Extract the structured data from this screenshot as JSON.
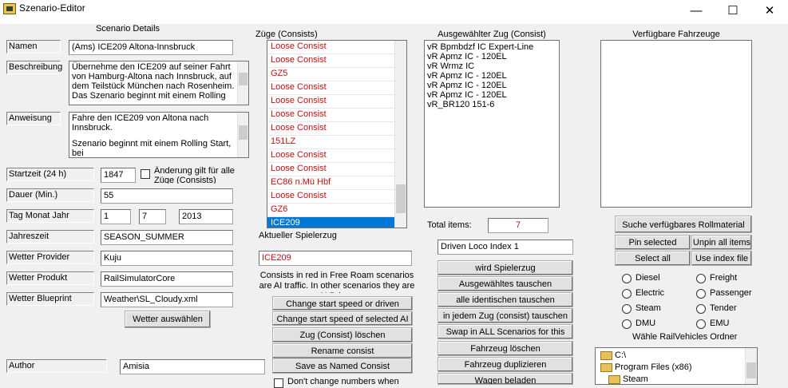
{
  "window": {
    "title": "Szenario-Editor",
    "minimize": "—",
    "maximize": "☐",
    "close": "✕"
  },
  "details": {
    "heading": "Scenario Details",
    "name_label": "Namen",
    "name_value": "(Ams) ICE209 Altona-Innsbruck",
    "desc_label": "Beschreibung",
    "desc_value": "Übernehme den ICE209 auf seiner Fahrt von Hamburg-Altona nach Innsbruck, auf dem Teilstück München nach Rosenheim. Das Szenario beginnt mit einem Rolling",
    "instr_label": "Anweisung",
    "instr_line1": "Fahre den ICE209 von Altona nach Innsbruck.",
    "instr_line2": "Szenario beginnt mit einem Rolling Start, bei",
    "start_label": "Startzeit (24 h)",
    "start_value": "1847",
    "change_all_label": "Änderung gilt für alle Züge (Consists)",
    "duration_label": "Dauer (Min.)",
    "duration_value": "55",
    "date_label": "Tag Monat Jahr",
    "day": "1",
    "month": "7",
    "year": "2013",
    "season_label": "Jahreszeit",
    "season_value": "SEASON_SUMMER",
    "weather_provider_label": "Wetter Provider",
    "weather_provider_value": "Kuju",
    "weather_product_label": "Wetter Produkt",
    "weather_product_value": "RailSimulatorCore",
    "weather_blueprint_label": "Wetter Blueprint",
    "weather_blueprint_value": "Weather\\SL_Cloudy.xml",
    "weather_button": "Wetter auswählen",
    "author_label": "Author",
    "author_value": "Amisia"
  },
  "consists": {
    "heading": "Züge (Consists)",
    "items": [
      "Loose Consist",
      "Loose Consist",
      "GZ5",
      "Loose Consist",
      "Loose Consist",
      "Loose Consist",
      "Loose Consist",
      "151LZ",
      "Loose Consist",
      "Loose Consist",
      "EC86 n.Mü Hbf",
      "Loose Consist",
      "GZ6",
      "ICE209"
    ],
    "player_label": "Aktueller Spielerzug",
    "player_value": "ICE209",
    "info": "Consists in red in Free Roam scenarios are AI traffic. In other scenarios they are AI Driven",
    "btn_change_start": "Change start speed or driven consist",
    "btn_change_start_ai": "Change start speed of selected AI consist",
    "btn_delete": "Zug (Consist) löschen",
    "btn_rename": "Rename consist",
    "btn_save_named": "Save as Named Consist",
    "dont_change": "Don't change numbers when"
  },
  "selected": {
    "heading": "Ausgewählter Zug (Consist)",
    "items": [
      "vR Bpmbdzf IC Expert-Line",
      "vR Apmz IC - 120EL",
      "vR Wrmz IC",
      "vR Apmz IC - 120EL",
      "vR Apmz IC - 120EL",
      "vR Apmz IC - 120EL",
      "vR_BR120 151-6"
    ],
    "total_label": "Total items:",
    "total_value": "7",
    "loco_index": "Driven Loco Index 1",
    "btn_player": "wird Spielerzug",
    "btn_swap_selected": "Ausgewähltes tauschen",
    "btn_swap_identical": "alle identischen tauschen",
    "btn_swap_every": "in jedem Zug (consist) tauschen",
    "btn_swap_all": "Swap in ALL Scenarios for this route",
    "btn_delete_vehicle": "Fahrzeug löschen",
    "btn_duplicate": "Fahrzeug duplizieren",
    "btn_load": "Wagen beladen"
  },
  "available": {
    "heading": "Verfügbare Fahrzeuge",
    "btn_search": "Suche verfügbares Rollmaterial",
    "btn_pin": "Pin selected",
    "btn_unpin": "Unpin all items",
    "btn_select_all": "Select all",
    "btn_use_index": "Use index file",
    "radios": [
      "Diesel",
      "Freight",
      "Electric",
      "Passenger",
      "Steam",
      "Tender",
      "DMU",
      "EMU"
    ],
    "folder_label": "Wähle RailVehicles Ordner",
    "tree": [
      "C:\\",
      "Program Files (x86)",
      "Steam"
    ]
  }
}
